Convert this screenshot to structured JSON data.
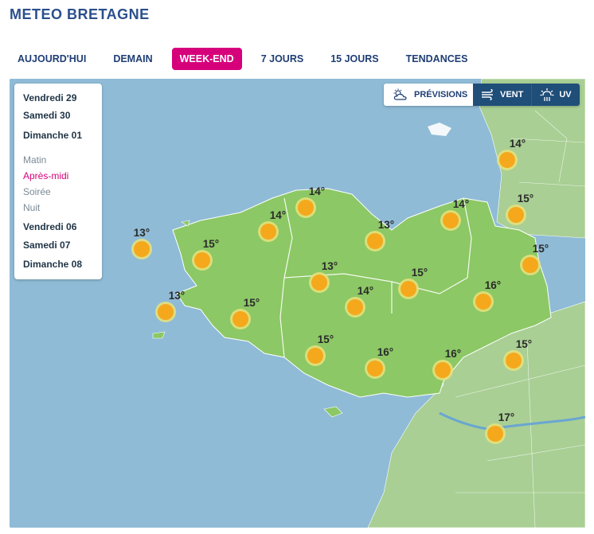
{
  "app": {
    "title": "METEO BRETAGNE"
  },
  "tabs": [
    {
      "label": "AUJOURD'HUI",
      "active": false
    },
    {
      "label": "DEMAIN",
      "active": false
    },
    {
      "label": "WEEK-END",
      "active": true
    },
    {
      "label": "7 JOURS",
      "active": false
    },
    {
      "label": "15 JOURS",
      "active": false
    },
    {
      "label": "TENDANCES",
      "active": false
    }
  ],
  "days_panel": {
    "days_top": [
      "Vendredi 29",
      "Samedi 30",
      "Dimanche 01"
    ],
    "periods": [
      {
        "label": "Matin",
        "active": false
      },
      {
        "label": "Après-midi",
        "active": true
      },
      {
        "label": "Soirée",
        "active": false
      },
      {
        "label": "Nuit",
        "active": false
      }
    ],
    "days_bottom": [
      "Vendredi 06",
      "Samedi 07",
      "Dimanche 08"
    ]
  },
  "modes": [
    {
      "label": "PRÉVISIONS",
      "icon": "cloud-sun-icon",
      "active": true
    },
    {
      "label": "VENT",
      "icon": "wind-icon",
      "active": false
    },
    {
      "label": "UV",
      "icon": "uv-sun-icon",
      "active": false
    }
  ],
  "colors": {
    "accent": "#d6007b",
    "brand": "#2b4f8c",
    "sea": "#8fbbd6",
    "land_region": "#8cc865",
    "land_outside": "#a9cf94",
    "sun": "#f5a81c"
  },
  "forecast": [
    {
      "temp": "13°",
      "condition": "sunny"
    },
    {
      "temp": "15°",
      "condition": "sunny"
    },
    {
      "temp": "14°",
      "condition": "sunny"
    },
    {
      "temp": "14°",
      "condition": "sunny"
    },
    {
      "temp": "13°",
      "condition": "sunny"
    },
    {
      "temp": "14°",
      "condition": "sunny"
    },
    {
      "temp": "14°",
      "condition": "sunny"
    },
    {
      "temp": "15°",
      "condition": "sunny"
    },
    {
      "temp": "13°",
      "condition": "sunny"
    },
    {
      "temp": "15°",
      "condition": "sunny"
    },
    {
      "temp": "13°",
      "condition": "sunny"
    },
    {
      "temp": "14°",
      "condition": "sunny"
    },
    {
      "temp": "15°",
      "condition": "sunny"
    },
    {
      "temp": "15°",
      "condition": "sunny"
    },
    {
      "temp": "16°",
      "condition": "sunny"
    },
    {
      "temp": "15°",
      "condition": "sunny"
    },
    {
      "temp": "16°",
      "condition": "sunny"
    },
    {
      "temp": "16°",
      "condition": "sunny"
    },
    {
      "temp": "15°",
      "condition": "sunny"
    },
    {
      "temp": "17°",
      "condition": "sunny"
    }
  ]
}
